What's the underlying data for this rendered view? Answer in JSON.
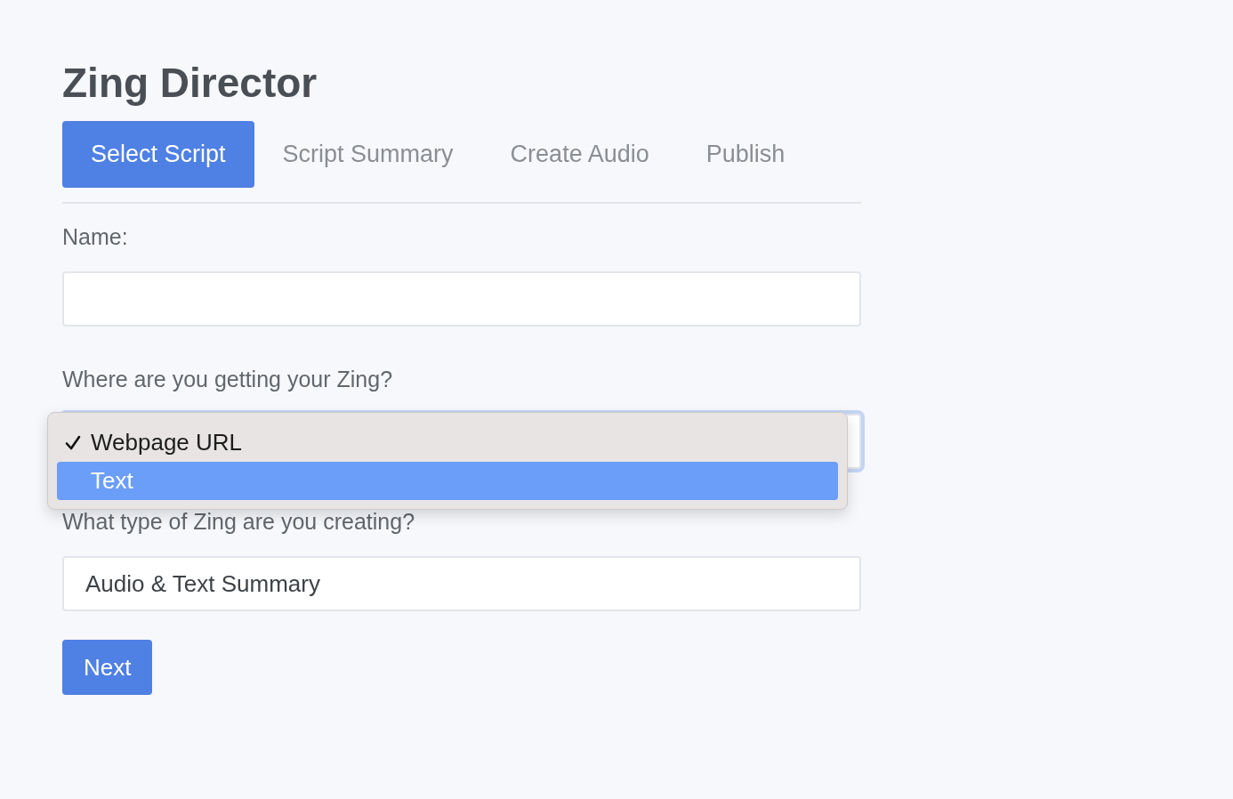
{
  "title": "Zing Director",
  "tabs": [
    {
      "label": "Select Script",
      "selected": true
    },
    {
      "label": "Script Summary",
      "selected": false
    },
    {
      "label": "Create Audio",
      "selected": false
    },
    {
      "label": "Publish",
      "selected": false
    }
  ],
  "fields": [
    {
      "kind": "input",
      "label": "Name:"
    },
    {
      "kind": "select",
      "label": "Where are you getting your Zing?",
      "focused": true,
      "menu": [
        {
          "label": "Webpage URL",
          "checked": true,
          "selected": false
        },
        {
          "label": "Text",
          "checked": false,
          "selected": true
        }
      ]
    },
    {
      "kind": "select",
      "label": "What type of Zing are you creating?",
      "value": "Audio & Text Summary",
      "focused": false
    }
  ],
  "button": "Next"
}
